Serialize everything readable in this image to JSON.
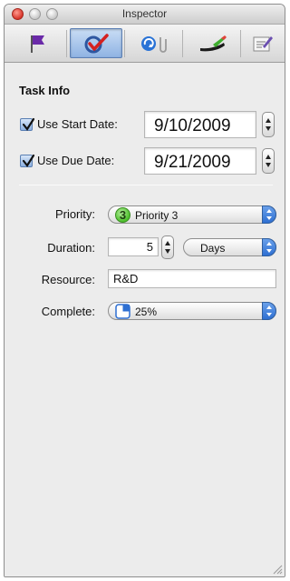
{
  "window": {
    "title": "Inspector"
  },
  "toolbar": {
    "buttons": [
      {
        "name": "flag-icon",
        "selected": false
      },
      {
        "name": "task-check-icon",
        "selected": true
      },
      {
        "name": "link-attachment-icon",
        "selected": false
      },
      {
        "name": "brush-icon",
        "selected": false
      },
      {
        "name": "notes-icon",
        "selected": false
      }
    ]
  },
  "task_info": {
    "section_title": "Task Info",
    "start_date": {
      "label": "Use Start Date:",
      "checked": true,
      "value": "9/10/2009"
    },
    "due_date": {
      "label": "Use Due Date:",
      "checked": true,
      "value": "9/21/2009"
    },
    "priority": {
      "label": "Priority:",
      "badge": "3",
      "value": "Priority 3"
    },
    "duration": {
      "label": "Duration:",
      "value": "5",
      "unit": "Days"
    },
    "resource": {
      "label": "Resource:",
      "value": "R&D"
    },
    "complete": {
      "label": "Complete:",
      "value": "25%",
      "fraction": 0.25
    }
  },
  "colors": {
    "accent": "#2e6fd2",
    "priority_green": "#4bbf2a"
  }
}
